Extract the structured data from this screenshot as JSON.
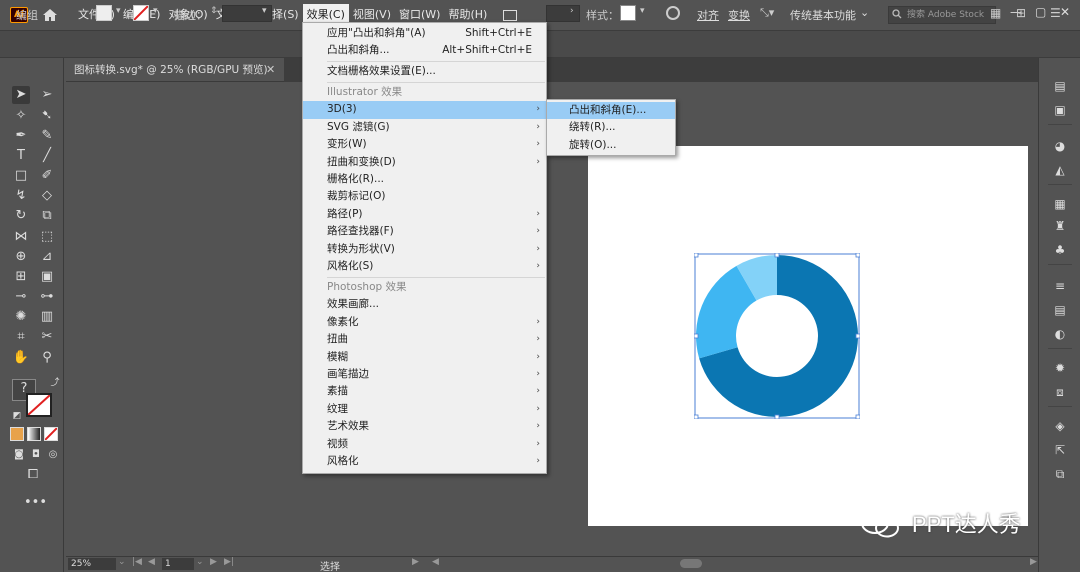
{
  "app": {
    "logo": "Ai"
  },
  "menubar": {
    "items": [
      "文件(F)",
      "编辑(E)",
      "对象(O)",
      "文字(T)",
      "选择(S)",
      "效果(C)",
      "视图(V)",
      "窗口(W)",
      "帮助(H)"
    ],
    "active_index": 5,
    "workspace": "传统基本功能",
    "stock_search_placeholder": "搜索 Adobe Stock",
    "window_controls": [
      "—",
      "▢",
      "✕"
    ]
  },
  "controlbar": {
    "selection_label": "编组",
    "stroke_label": "描边：",
    "style_label": "样式：",
    "align_label": "对齐",
    "transform_label": "变换"
  },
  "document": {
    "tab_title": "图标转换.svg* @ 25% (RGB/GPU 预览)",
    "tab_close": "✕"
  },
  "statusbar": {
    "zoom": "25%",
    "page": "1",
    "current_tool": "选择"
  },
  "effect_menu": {
    "items": [
      {
        "label": "应用\"凸出和斜角\"(A)",
        "shortcut": "Shift+Ctrl+E"
      },
      {
        "label": "凸出和斜角...",
        "shortcut": "Alt+Shift+Ctrl+E"
      },
      {
        "label": "文档栅格效果设置(E)..."
      },
      {
        "label": "Illustrator 效果",
        "header": true
      },
      {
        "label": "3D(3)",
        "submenu": true,
        "highlighted": true
      },
      {
        "label": "SVG 滤镜(G)",
        "submenu": true
      },
      {
        "label": "变形(W)",
        "submenu": true
      },
      {
        "label": "扭曲和变换(D)",
        "submenu": true
      },
      {
        "label": "栅格化(R)..."
      },
      {
        "label": "裁剪标记(O)"
      },
      {
        "label": "路径(P)",
        "submenu": true
      },
      {
        "label": "路径查找器(F)",
        "submenu": true
      },
      {
        "label": "转换为形状(V)",
        "submenu": true
      },
      {
        "label": "风格化(S)",
        "submenu": true
      },
      {
        "label": "Photoshop 效果",
        "header": true
      },
      {
        "label": "效果画廊..."
      },
      {
        "label": "像素化",
        "submenu": true
      },
      {
        "label": "扭曲",
        "submenu": true
      },
      {
        "label": "模糊",
        "submenu": true
      },
      {
        "label": "画笔描边",
        "submenu": true
      },
      {
        "label": "素描",
        "submenu": true
      },
      {
        "label": "纹理",
        "submenu": true
      },
      {
        "label": "艺术效果",
        "submenu": true
      },
      {
        "label": "视频",
        "submenu": true
      },
      {
        "label": "风格化",
        "submenu": true
      }
    ]
  },
  "submenu_3d": {
    "items": [
      "凸出和斜角(E)...",
      "绕转(R)...",
      "旋转(O)..."
    ],
    "highlighted_index": 0
  },
  "artwork": {
    "segments": [
      {
        "name": "dark-blue",
        "color": "#0b76b2",
        "start_deg": 0,
        "end_deg": 254
      },
      {
        "name": "medium-blue",
        "color": "#3fb6f2",
        "start_deg": 254,
        "end_deg": 330
      },
      {
        "name": "light-blue",
        "color": "#83d2f8",
        "start_deg": 330,
        "end_deg": 360
      }
    ]
  },
  "watermark": {
    "text": "PPT达人秀"
  }
}
